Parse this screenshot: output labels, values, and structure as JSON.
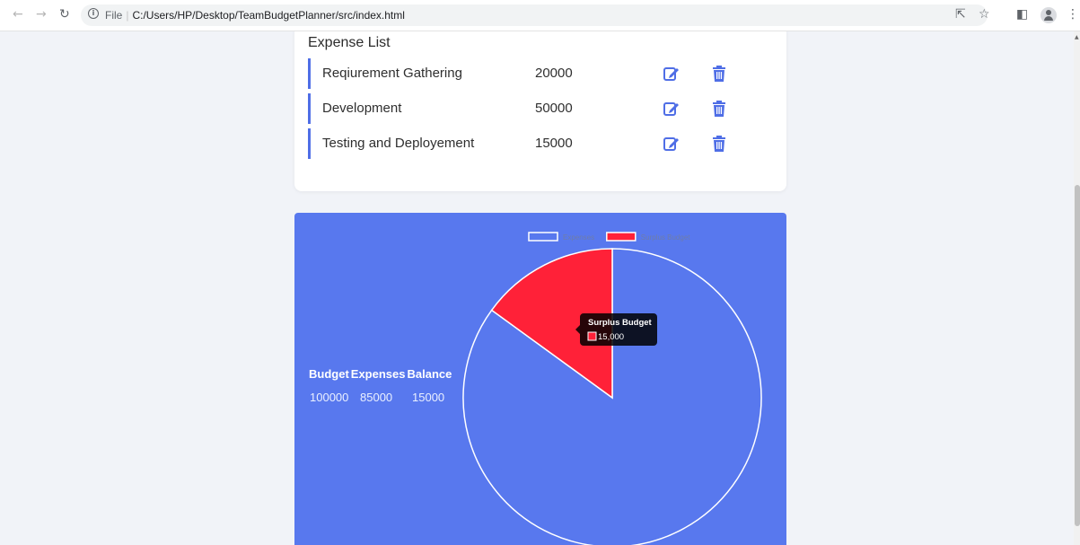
{
  "browser": {
    "url_prefix": "File",
    "url_path": "C:/Users/HP/Desktop/TeamBudgetPlanner/src/index.html"
  },
  "expense_list": {
    "title": "Expense List",
    "items": [
      {
        "name": "Reqiurement Gathering",
        "amount": "20000"
      },
      {
        "name": "Development",
        "amount": "50000"
      },
      {
        "name": "Testing and Deployement",
        "amount": "15000"
      }
    ]
  },
  "summary": {
    "budget_label": "Budget",
    "expenses_label": "Expenses",
    "balance_label": "Balance",
    "budget_value": "100000",
    "expenses_value": "85000",
    "balance_value": "15000"
  },
  "chart_data": {
    "type": "pie",
    "categories": [
      "Expenses",
      "Surplus Budget"
    ],
    "values": [
      85000,
      15000
    ],
    "colors": [
      "#5878ee",
      "#ff2138"
    ],
    "legend_position": "top",
    "tooltip": {
      "title": "Surplus Budget",
      "value": "15,000"
    }
  },
  "colors": {
    "accent": "#4f6ee6",
    "panel": "#5878ee",
    "surplus": "#ff2138"
  }
}
